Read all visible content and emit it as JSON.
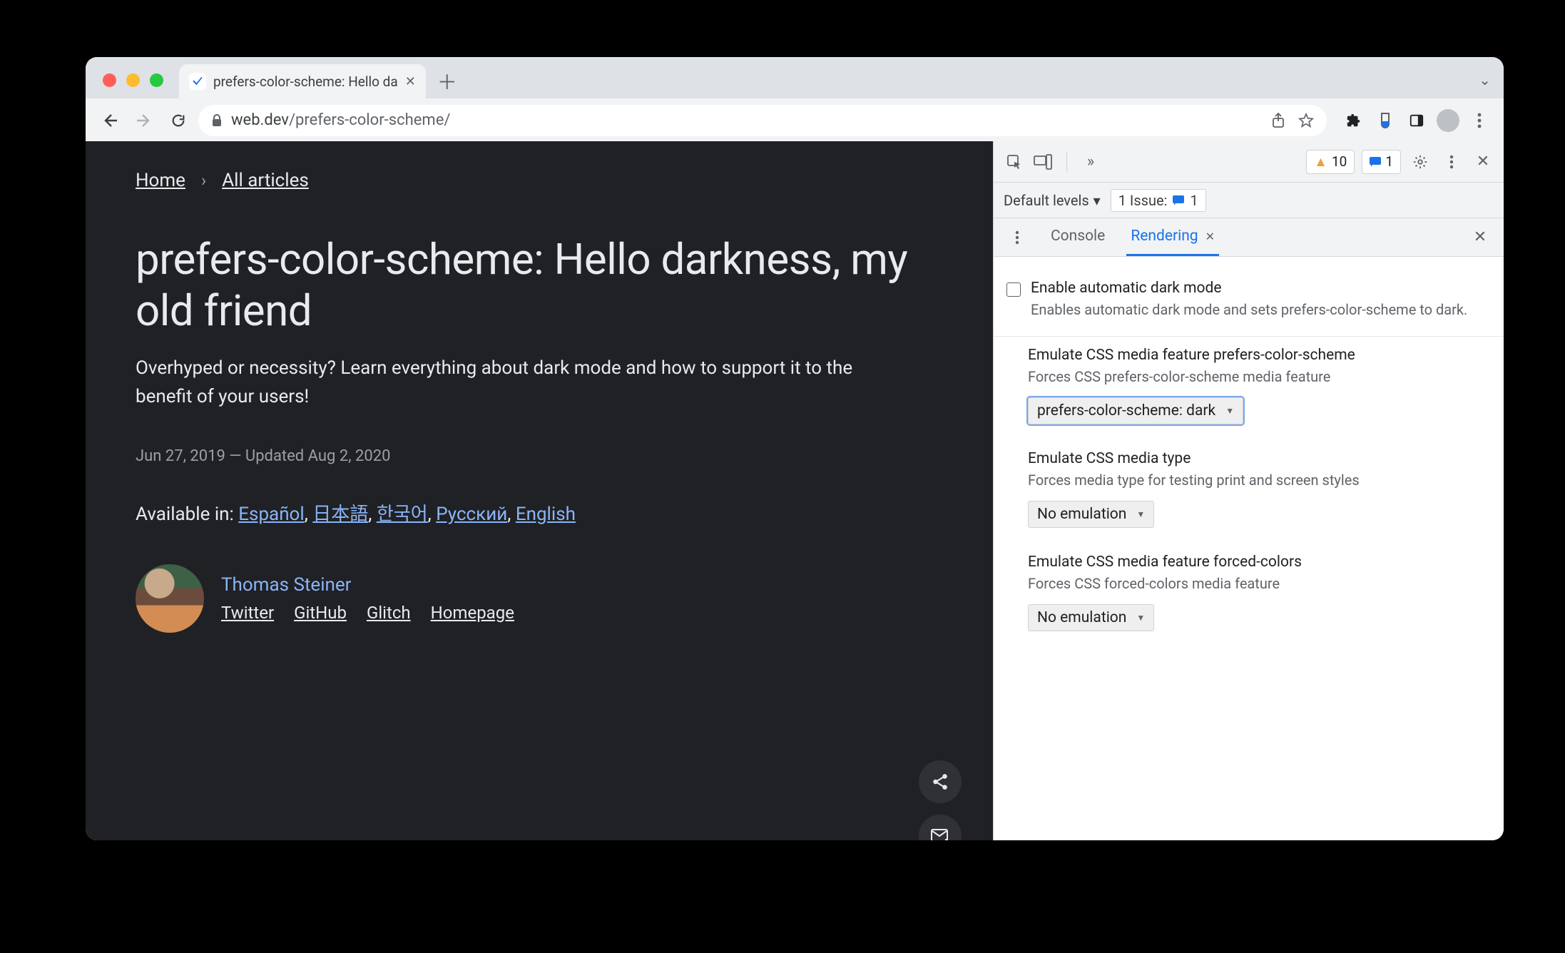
{
  "tab": {
    "title": "prefers-color-scheme: Hello da"
  },
  "url": {
    "host": "web.dev",
    "path": "/prefers-color-scheme/"
  },
  "breadcrumbs": {
    "home": "Home",
    "all": "All articles"
  },
  "article": {
    "title": "prefers-color-scheme: Hello darkness, my old friend",
    "subtitle": "Overhyped or necessity? Learn everything about dark mode and how to support it to the benefit of your users!",
    "dates": "Jun 27, 2019 — Updated Aug 2, 2020",
    "available_label": "Available in: ",
    "langs": [
      "Español",
      "日本語",
      "한국어",
      "Русский",
      "English"
    ],
    "author": {
      "name": "Thomas Steiner",
      "links": [
        "Twitter",
        "GitHub",
        "Glitch",
        "Homepage"
      ]
    }
  },
  "devtools": {
    "warnings": "10",
    "messages": "1",
    "default_levels": "Default levels",
    "issue_label": "1 Issue:",
    "issue_count": "1",
    "tabs": {
      "console": "Console",
      "rendering": "Rendering"
    },
    "sections": {
      "darkmode": {
        "title": "Enable automatic dark mode",
        "desc": "Enables automatic dark mode and sets prefers-color-scheme to dark."
      },
      "pcs": {
        "title": "Emulate CSS media feature prefers-color-scheme",
        "desc": "Forces CSS prefers-color-scheme media feature",
        "value": "prefers-color-scheme: dark"
      },
      "mediatype": {
        "title": "Emulate CSS media type",
        "desc": "Forces media type for testing print and screen styles",
        "value": "No emulation"
      },
      "forced": {
        "title": "Emulate CSS media feature forced-colors",
        "desc": "Forces CSS forced-colors media feature",
        "value": "No emulation"
      }
    }
  }
}
